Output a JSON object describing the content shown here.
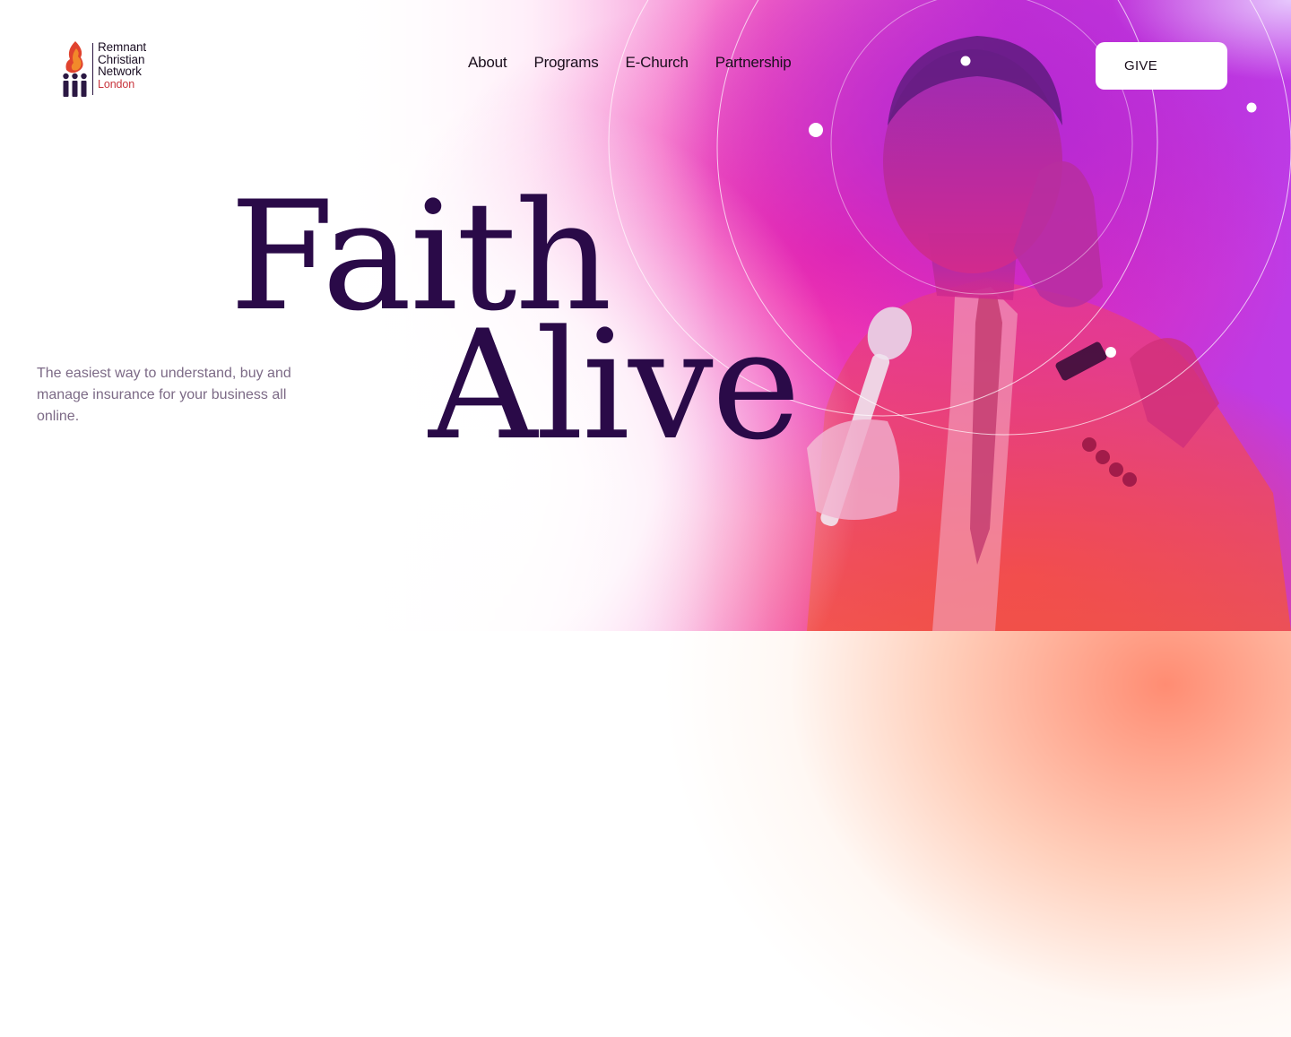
{
  "brand": {
    "name_line1": "Remnant",
    "name_line2": "Christian",
    "name_line3": "Network",
    "city": "London"
  },
  "nav": {
    "items": [
      {
        "label": "About"
      },
      {
        "label": "Programs"
      },
      {
        "label": "E-Church"
      },
      {
        "label": "Partnership"
      }
    ]
  },
  "header": {
    "give_label": "GIVE"
  },
  "hero": {
    "title_line1": "Faith",
    "title_line2": "Alive",
    "tagline": "The easiest way to understand, buy and manage insurance for your business all online."
  },
  "colors": {
    "headline": "#2a0a48",
    "tagline": "#7c6a86",
    "accent_magenta": "#ee24aa",
    "accent_purple": "#af28d7",
    "accent_red": "#fc424a",
    "brand_red": "#c8353d"
  }
}
